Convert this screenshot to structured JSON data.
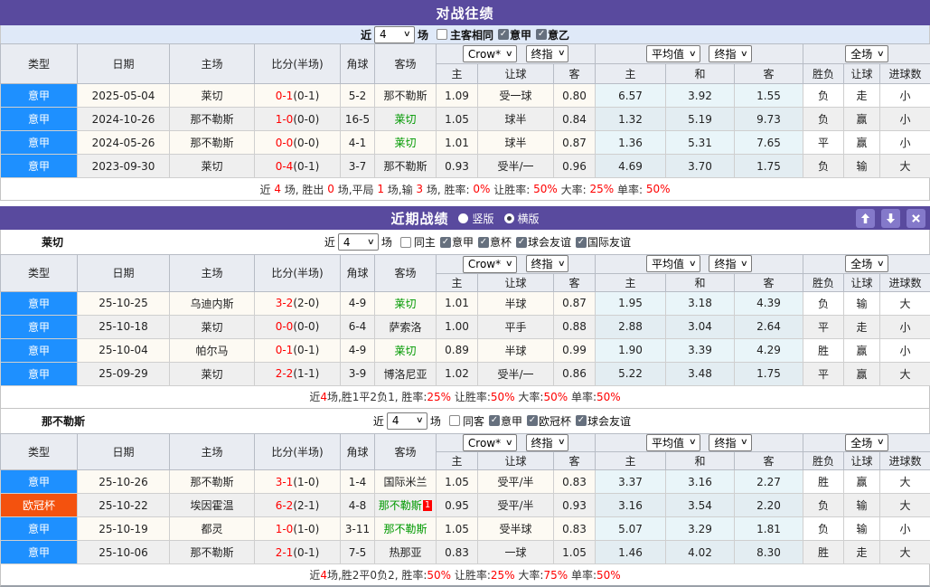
{
  "colors": {
    "header_purple": "#594a9e",
    "header_button_purple": "#8479ca",
    "league_blue": "#1e90ff",
    "league_orange": "#f4520e",
    "team_green": "#009900",
    "score_red": "#ff0000",
    "win_red": "#e60000",
    "draw_green": "#009900",
    "loss_blue": "#3a3ad9",
    "filter_row_blue": "#dfe9f8"
  },
  "icons": {
    "dropdown": "chevron-down",
    "check": "checkmark",
    "up": "up-arrow",
    "down": "down-arrow",
    "close": "close-x"
  },
  "headers": {
    "type": "类型",
    "date": "日期",
    "home": "主场",
    "score": "比分(半场)",
    "corner": "角球",
    "away": "客场",
    "odds_src": "Crow*",
    "final": "终指",
    "avg": "平均值",
    "full": "全场",
    "h": "主",
    "handicap": "让球",
    "a": "客",
    "draw": "和",
    "wl": "胜负",
    "goals": "进球数"
  },
  "h2h": {
    "title": "对战往绩",
    "filter": {
      "near": "近",
      "count": "4",
      "unit": "场",
      "uncheck_label": "主客相同",
      "leagues": [
        "意甲",
        "意乙"
      ]
    },
    "rows": [
      {
        "league": "意甲",
        "lc": "blue",
        "date": "2025-05-04",
        "home": "莱切",
        "hg": true,
        "ft": "0-1",
        "ht": "(0-1)",
        "corner": "5-2",
        "away": "那不勒斯",
        "ag": false,
        "badge": "",
        "o1": "1.09",
        "o2": "受一球",
        "o3": "0.80",
        "a1": "6.57",
        "a2": "3.92",
        "a3": "1.55",
        "r1": "负",
        "c1": "b",
        "r2": "走",
        "c2": "g",
        "r3": "小",
        "c3": "b"
      },
      {
        "league": "意甲",
        "lc": "blue",
        "date": "2024-10-26",
        "home": "那不勒斯",
        "hg": false,
        "ft": "1-0",
        "ht": "(0-0)",
        "corner": "16-5",
        "away": "莱切",
        "ag": true,
        "badge": "",
        "o1": "1.05",
        "o2": "球半",
        "o3": "0.84",
        "a1": "1.32",
        "a2": "5.19",
        "a3": "9.73",
        "r1": "负",
        "c1": "b",
        "r2": "赢",
        "c2": "r",
        "r3": "小",
        "c3": "b"
      },
      {
        "league": "意甲",
        "lc": "blue",
        "date": "2024-05-26",
        "home": "那不勒斯",
        "hg": false,
        "ft": "0-0",
        "ht": "(0-0)",
        "corner": "4-1",
        "away": "莱切",
        "ag": true,
        "badge": "",
        "o1": "1.01",
        "o2": "球半",
        "o3": "0.87",
        "a1": "1.36",
        "a2": "5.31",
        "a3": "7.65",
        "r1": "平",
        "c1": "g",
        "r2": "赢",
        "c2": "r",
        "r3": "小",
        "c3": "b"
      },
      {
        "league": "意甲",
        "lc": "blue",
        "date": "2023-09-30",
        "home": "莱切",
        "hg": true,
        "ft": "0-4",
        "ht": "(0-1)",
        "corner": "3-7",
        "away": "那不勒斯",
        "ag": false,
        "badge": "",
        "o1": "0.93",
        "o2": "受半/一",
        "o3": "0.96",
        "a1": "4.69",
        "a2": "3.70",
        "a3": "1.75",
        "r1": "负",
        "c1": "b",
        "r2": "输",
        "c2": "b",
        "r3": "大",
        "c3": "r"
      }
    ],
    "summary": [
      {
        "t": "近 ",
        "c": "k"
      },
      {
        "t": "4",
        "c": "r"
      },
      {
        "t": " 场, 胜出 ",
        "c": "k"
      },
      {
        "t": "0",
        "c": "r"
      },
      {
        "t": " 场,平局 ",
        "c": "k"
      },
      {
        "t": "1",
        "c": "r"
      },
      {
        "t": " 场,输 ",
        "c": "k"
      },
      {
        "t": "3",
        "c": "r"
      },
      {
        "t": " 场, 胜率: ",
        "c": "k"
      },
      {
        "t": "0%",
        "c": "r"
      },
      {
        "t": " 让胜率: ",
        "c": "k"
      },
      {
        "t": "50%",
        "c": "r"
      },
      {
        "t": " 大率: ",
        "c": "k"
      },
      {
        "t": "25%",
        "c": "r"
      },
      {
        "t": " 单率: ",
        "c": "k"
      },
      {
        "t": "50%",
        "c": "r"
      }
    ]
  },
  "recent": {
    "title": "近期战绩",
    "radio_vertical": "竖版",
    "radio_horizontal": "横版",
    "selected_layout": "横版",
    "teams": [
      {
        "name": "莱切",
        "filter": {
          "near": "近",
          "count": "4",
          "unit": "场",
          "uncheck_label": "同主",
          "leagues": [
            "意甲",
            "意杯",
            "球会友谊",
            "国际友谊"
          ]
        },
        "rows": [
          {
            "league": "意甲",
            "lc": "blue",
            "date": "25-10-25",
            "home": "乌迪内斯",
            "hg": false,
            "ft": "3-2",
            "ht": "(2-0)",
            "corner": "4-9",
            "away": "莱切",
            "ag": true,
            "badge": "",
            "o1": "1.01",
            "o2": "半球",
            "o3": "0.87",
            "a1": "1.95",
            "a2": "3.18",
            "a3": "4.39",
            "r1": "负",
            "c1": "b",
            "r2": "输",
            "c2": "b",
            "r3": "大",
            "c3": "r"
          },
          {
            "league": "意甲",
            "lc": "blue",
            "date": "25-10-18",
            "home": "莱切",
            "hg": true,
            "ft": "0-0",
            "ht": "(0-0)",
            "corner": "6-4",
            "away": "萨索洛",
            "ag": false,
            "badge": "",
            "o1": "1.00",
            "o2": "平手",
            "o3": "0.88",
            "a1": "2.88",
            "a2": "3.04",
            "a3": "2.64",
            "r1": "平",
            "c1": "g",
            "r2": "走",
            "c2": "g",
            "r3": "小",
            "c3": "b"
          },
          {
            "league": "意甲",
            "lc": "blue",
            "date": "25-10-04",
            "home": "帕尔马",
            "hg": false,
            "ft": "0-1",
            "ht": "(0-1)",
            "corner": "4-9",
            "away": "莱切",
            "ag": true,
            "badge": "",
            "o1": "0.89",
            "o2": "半球",
            "o3": "0.99",
            "a1": "1.90",
            "a2": "3.39",
            "a3": "4.29",
            "r1": "胜",
            "c1": "r",
            "r2": "赢",
            "c2": "r",
            "r3": "小",
            "c3": "b"
          },
          {
            "league": "意甲",
            "lc": "blue",
            "date": "25-09-29",
            "home": "莱切",
            "hg": true,
            "ft": "2-2",
            "ht": "(1-1)",
            "corner": "3-9",
            "away": "博洛尼亚",
            "ag": false,
            "badge": "",
            "o1": "1.02",
            "o2": "受半/一",
            "o3": "0.86",
            "a1": "5.22",
            "a2": "3.48",
            "a3": "1.75",
            "r1": "平",
            "c1": "g",
            "r2": "赢",
            "c2": "r",
            "r3": "大",
            "c3": "r"
          }
        ],
        "summary": [
          {
            "t": "近",
            "c": "k"
          },
          {
            "t": "4",
            "c": "r"
          },
          {
            "t": "场,胜1平2负1, 胜率:",
            "c": "k"
          },
          {
            "t": "25%",
            "c": "r"
          },
          {
            "t": " 让胜率:",
            "c": "k"
          },
          {
            "t": "50%",
            "c": "r"
          },
          {
            "t": " 大率:",
            "c": "k"
          },
          {
            "t": "50%",
            "c": "r"
          },
          {
            "t": " 单率:",
            "c": "k"
          },
          {
            "t": "50%",
            "c": "r"
          }
        ]
      },
      {
        "name": "那不勒斯",
        "filter": {
          "near": "近",
          "count": "4",
          "unit": "场",
          "uncheck_label": "同客",
          "leagues": [
            "意甲",
            "欧冠杯",
            "球会友谊"
          ]
        },
        "rows": [
          {
            "league": "意甲",
            "lc": "blue",
            "date": "25-10-26",
            "home": "那不勒斯",
            "hg": true,
            "ft": "3-1",
            "ht": "(1-0)",
            "corner": "1-4",
            "away": "国际米兰",
            "ag": false,
            "badge": "",
            "o1": "1.05",
            "o2": "受平/半",
            "o3": "0.83",
            "a1": "3.37",
            "a2": "3.16",
            "a3": "2.27",
            "r1": "胜",
            "c1": "r",
            "r2": "赢",
            "c2": "r",
            "r3": "大",
            "c3": "r"
          },
          {
            "league": "欧冠杯",
            "lc": "orange",
            "date": "25-10-22",
            "home": "埃因霍温",
            "hg": false,
            "ft": "6-2",
            "ht": "(2-1)",
            "corner": "4-8",
            "away": "那不勒斯",
            "ag": true,
            "badge": "1",
            "o1": "0.95",
            "o2": "受平/半",
            "o3": "0.93",
            "a1": "3.16",
            "a2": "3.54",
            "a3": "2.20",
            "r1": "负",
            "c1": "b",
            "r2": "输",
            "c2": "b",
            "r3": "大",
            "c3": "r"
          },
          {
            "league": "意甲",
            "lc": "blue",
            "date": "25-10-19",
            "home": "都灵",
            "hg": false,
            "ft": "1-0",
            "ht": "(1-0)",
            "corner": "3-11",
            "away": "那不勒斯",
            "ag": true,
            "badge": "",
            "o1": "1.05",
            "o2": "受半球",
            "o3": "0.83",
            "a1": "5.07",
            "a2": "3.29",
            "a3": "1.81",
            "r1": "负",
            "c1": "b",
            "r2": "输",
            "c2": "b",
            "r3": "小",
            "c3": "b"
          },
          {
            "league": "意甲",
            "lc": "blue",
            "date": "25-10-06",
            "home": "那不勒斯",
            "hg": true,
            "ft": "2-1",
            "ht": "(0-1)",
            "corner": "7-5",
            "away": "热那亚",
            "ag": false,
            "badge": "",
            "o1": "0.83",
            "o2": "一球",
            "o3": "1.05",
            "a1": "1.46",
            "a2": "4.02",
            "a3": "8.30",
            "r1": "胜",
            "c1": "r",
            "r2": "走",
            "c2": "g",
            "r3": "大",
            "c3": "r"
          }
        ],
        "summary": [
          {
            "t": "近",
            "c": "k"
          },
          {
            "t": "4",
            "c": "r"
          },
          {
            "t": "场,胜2平0负2, 胜率:",
            "c": "k"
          },
          {
            "t": "50%",
            "c": "r"
          },
          {
            "t": " 让胜率:",
            "c": "k"
          },
          {
            "t": "25%",
            "c": "r"
          },
          {
            "t": " 大率:",
            "c": "k"
          },
          {
            "t": "75%",
            "c": "r"
          },
          {
            "t": " 单率:",
            "c": "k"
          },
          {
            "t": "50%",
            "c": "r"
          }
        ]
      }
    ]
  }
}
